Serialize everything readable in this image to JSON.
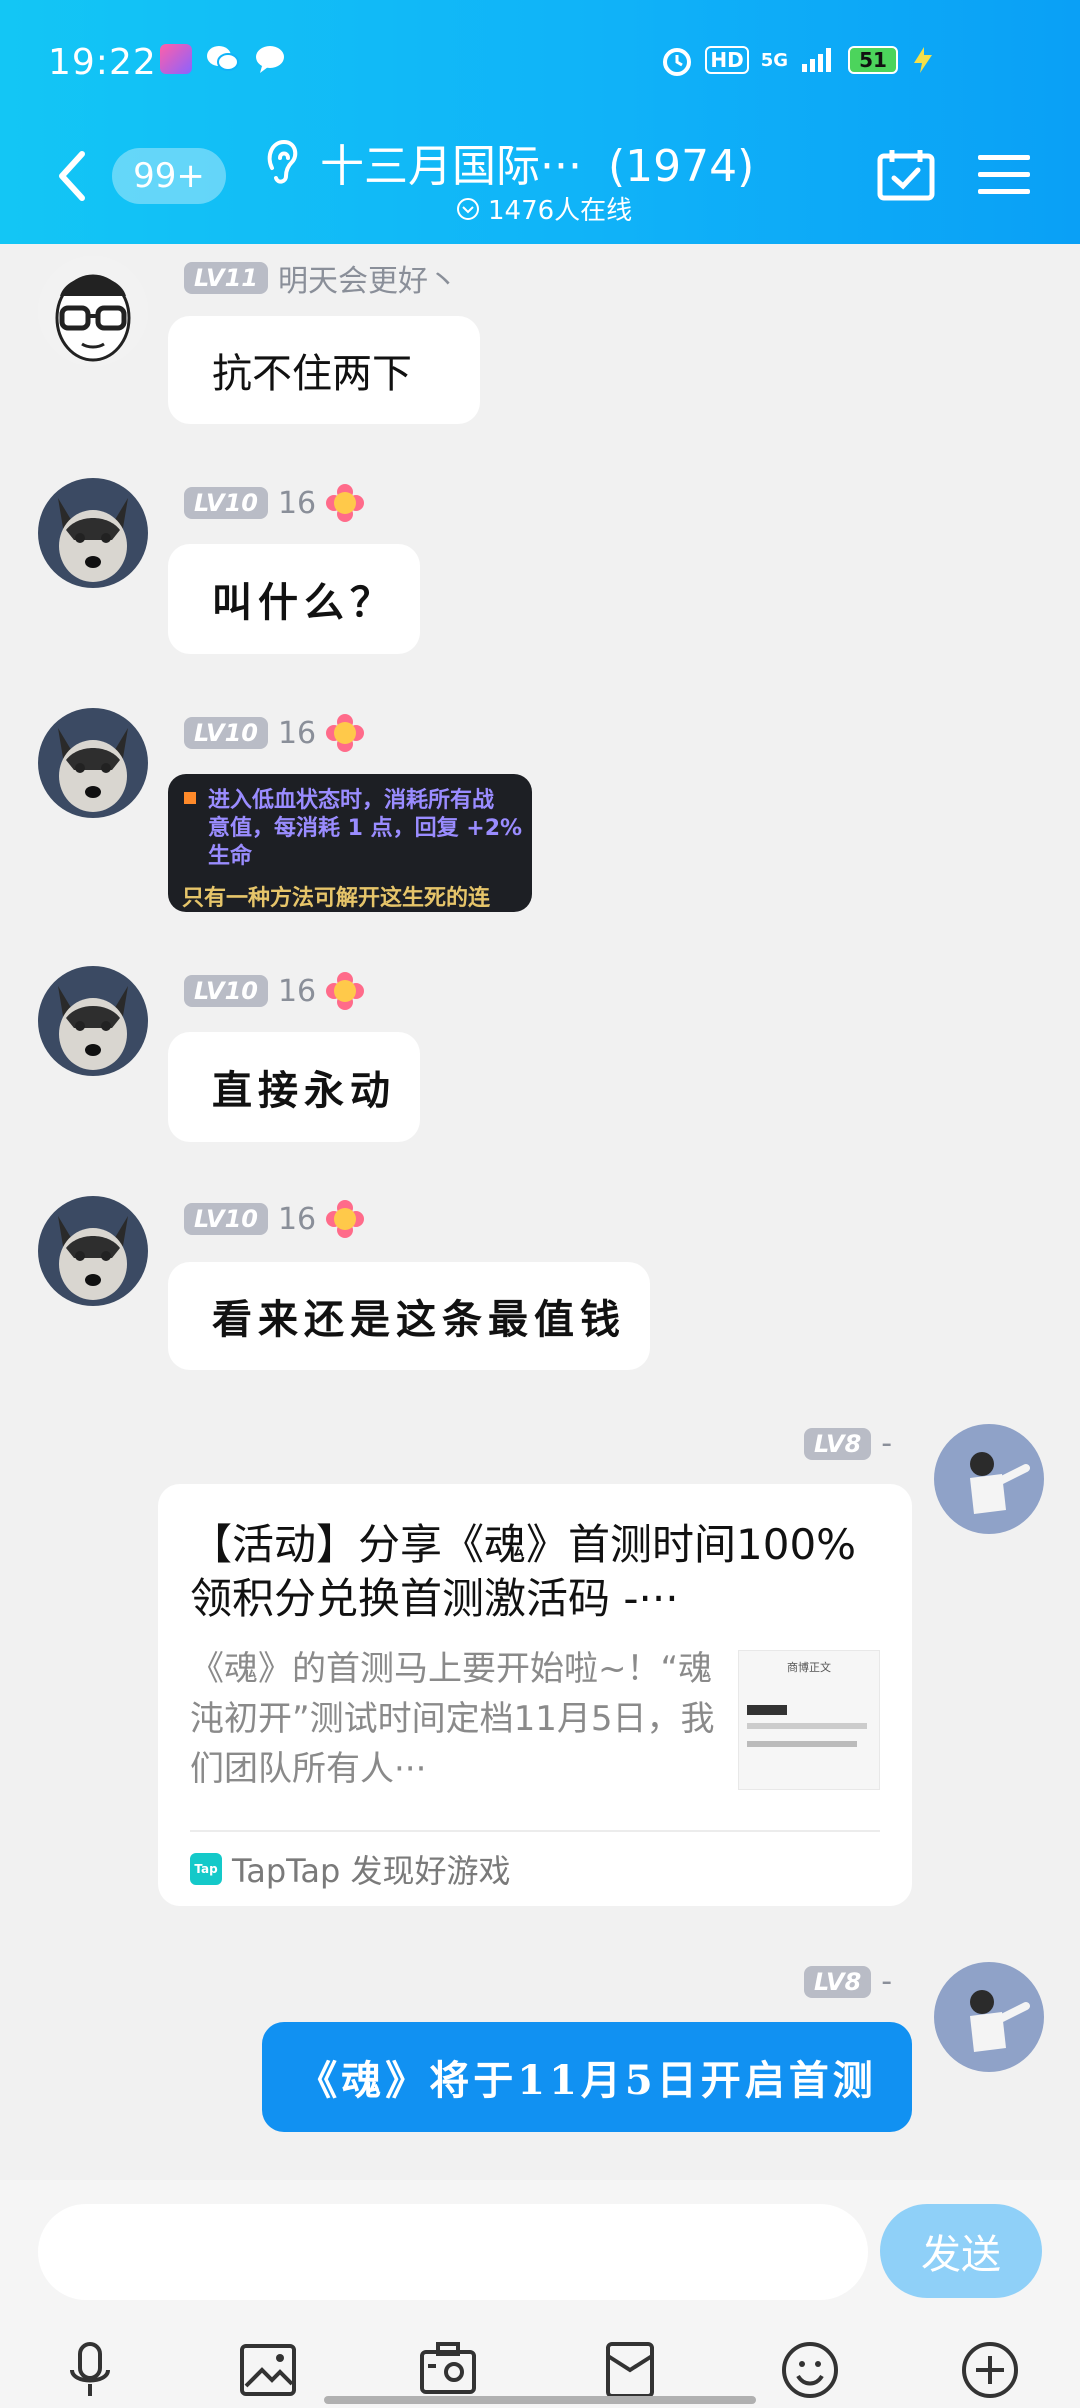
{
  "status_bar": {
    "time": "19:22",
    "battery": "51",
    "network": "5G",
    "hd": "HD",
    "icons": [
      "app-icon",
      "wechat-icon",
      "message-icon",
      "alarm-icon",
      "hd-icon",
      "signal-icon",
      "battery-icon",
      "charging-icon"
    ]
  },
  "header": {
    "unread_count": "99+",
    "title": "十三月国际···",
    "member_count": "(1974)",
    "online": "1476人在线",
    "colors": {
      "gradient_start": "#13c6f5",
      "gradient_end": "#0aa0f6"
    }
  },
  "messages": [
    {
      "avatar": "glasses-cartoon-avatar",
      "level": "LV11",
      "sender": "明天会更好丶",
      "text": "抗不住两下"
    },
    {
      "avatar": "husky-avatar",
      "level": "LV10",
      "sender": "16",
      "text": "叫什么？"
    },
    {
      "avatar": "husky-avatar",
      "level": "LV10",
      "sender": "16",
      "image_lines": [
        "进入低血状态时，消耗所有战",
        "意值，每消耗 1 点，回复 +2%",
        "生命",
        "只有一种方法可解开这生死的连"
      ]
    },
    {
      "avatar": "husky-avatar",
      "level": "LV10",
      "sender": "16",
      "text": "直接永动"
    },
    {
      "avatar": "husky-avatar",
      "level": "LV10",
      "sender": "16",
      "text": "看来还是这条最值钱"
    }
  ],
  "self_messages": [
    {
      "level": "LV8",
      "sender": "-",
      "card": {
        "title": "【活动】分享《魂》首测时间100%领积分兑换首测激活码 -···",
        "description": "《魂》的首测马上要开始啦~！“魂沌初开”测试时间定档11月5日，我们团队所有人···",
        "thumb_title": "商博正文",
        "source": "TapTap 发现好游戏",
        "source_logo": "Tap"
      }
    },
    {
      "level": "LV8",
      "sender": "-",
      "text": "《魂》将于11月5日开启首测"
    }
  ],
  "input": {
    "placeholder": "",
    "send_label": "发送"
  },
  "toolbar": [
    "microphone-icon",
    "photo-icon",
    "camera-icon",
    "red-packet-icon",
    "emoji-icon",
    "plus-icon"
  ]
}
